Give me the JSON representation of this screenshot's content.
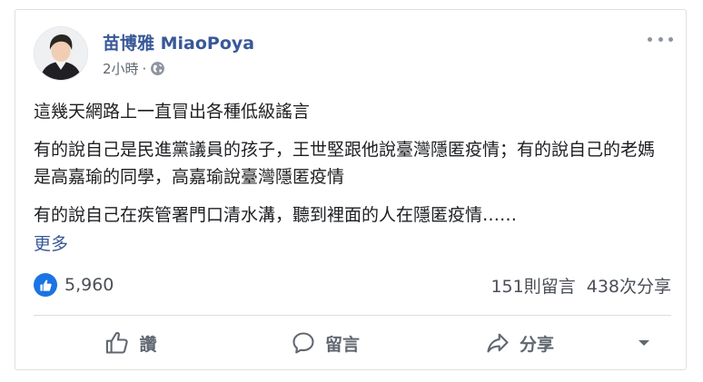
{
  "post": {
    "author": "苗博雅 MiaoPoya",
    "timestamp": "2小時",
    "separator": "·",
    "privacy_icon": "globe-icon",
    "menu_icon": "more-dots-icon",
    "paragraphs": [
      "這幾天網路上一直冒出各種低級謠言",
      "有的說自己是民進黨議員的孩子，王世堅跟他說臺灣隱匿疫情；有的說自己的老媽是高嘉瑜的同學，高嘉瑜說臺灣隱匿疫情",
      "有的說自己在疾管署門口清水溝，聽到裡面的人在隱匿疫情……"
    ],
    "see_more": "更多"
  },
  "stats": {
    "likes": "5,960",
    "comments": "151則留言",
    "shares": "438次分享"
  },
  "actions": {
    "like": "讚",
    "comment": "留言",
    "share": "分享"
  },
  "colors": {
    "link": "#385898",
    "like_blue": "#1b74e4",
    "muted": "#606770",
    "border": "#dddfe2"
  }
}
